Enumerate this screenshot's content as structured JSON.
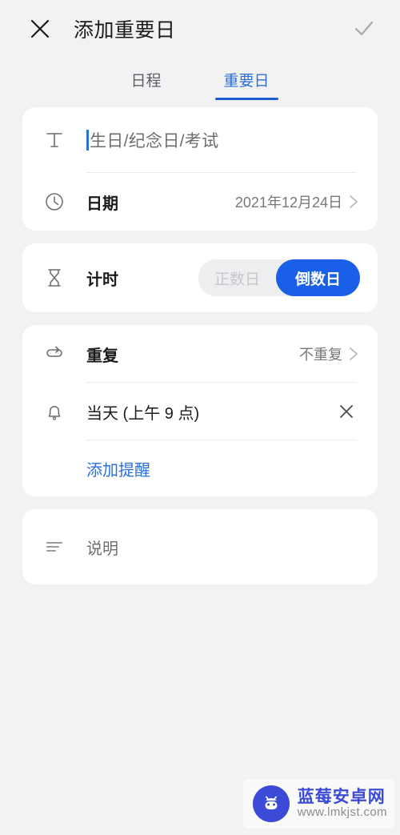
{
  "header": {
    "title": "添加重要日",
    "close_icon": "close-icon",
    "confirm_icon": "check-icon"
  },
  "tabs": [
    {
      "label": "日程",
      "active": false
    },
    {
      "label": "重要日",
      "active": true
    }
  ],
  "card_title": {
    "icon": "text-format-icon",
    "input_placeholder": "生日/纪念日/考试",
    "input_value": "",
    "date_row": {
      "icon": "clock-icon",
      "label": "日期",
      "value": "2021年12月24日",
      "chevron": "chevron-right-icon"
    }
  },
  "card_timer": {
    "icon": "hourglass-icon",
    "label": "计时",
    "options": [
      {
        "label": "正数日",
        "active": false
      },
      {
        "label": "倒数日",
        "active": true
      }
    ]
  },
  "card_repeat": {
    "repeat_row": {
      "icon": "repeat-icon",
      "label": "重复",
      "value": "不重复",
      "chevron": "chevron-right-icon"
    },
    "reminder_row": {
      "icon": "bell-icon",
      "text": "当天 (上午 9 点)",
      "remove_icon": "close-icon"
    },
    "add_reminder_label": "添加提醒"
  },
  "card_description": {
    "icon": "notes-icon",
    "placeholder": "说明"
  },
  "watermark": {
    "logo_icon": "android-robot-icon",
    "site_name": "蓝莓安卓网",
    "url": "www.lmkjst.com"
  },
  "colors": {
    "accent_blue": "#2b6fd8",
    "toggle_blue": "#1a5fe8",
    "page_background": "#f2f2f4",
    "card_background": "#ffffff",
    "watermark_blue": "#3b4bd8"
  }
}
